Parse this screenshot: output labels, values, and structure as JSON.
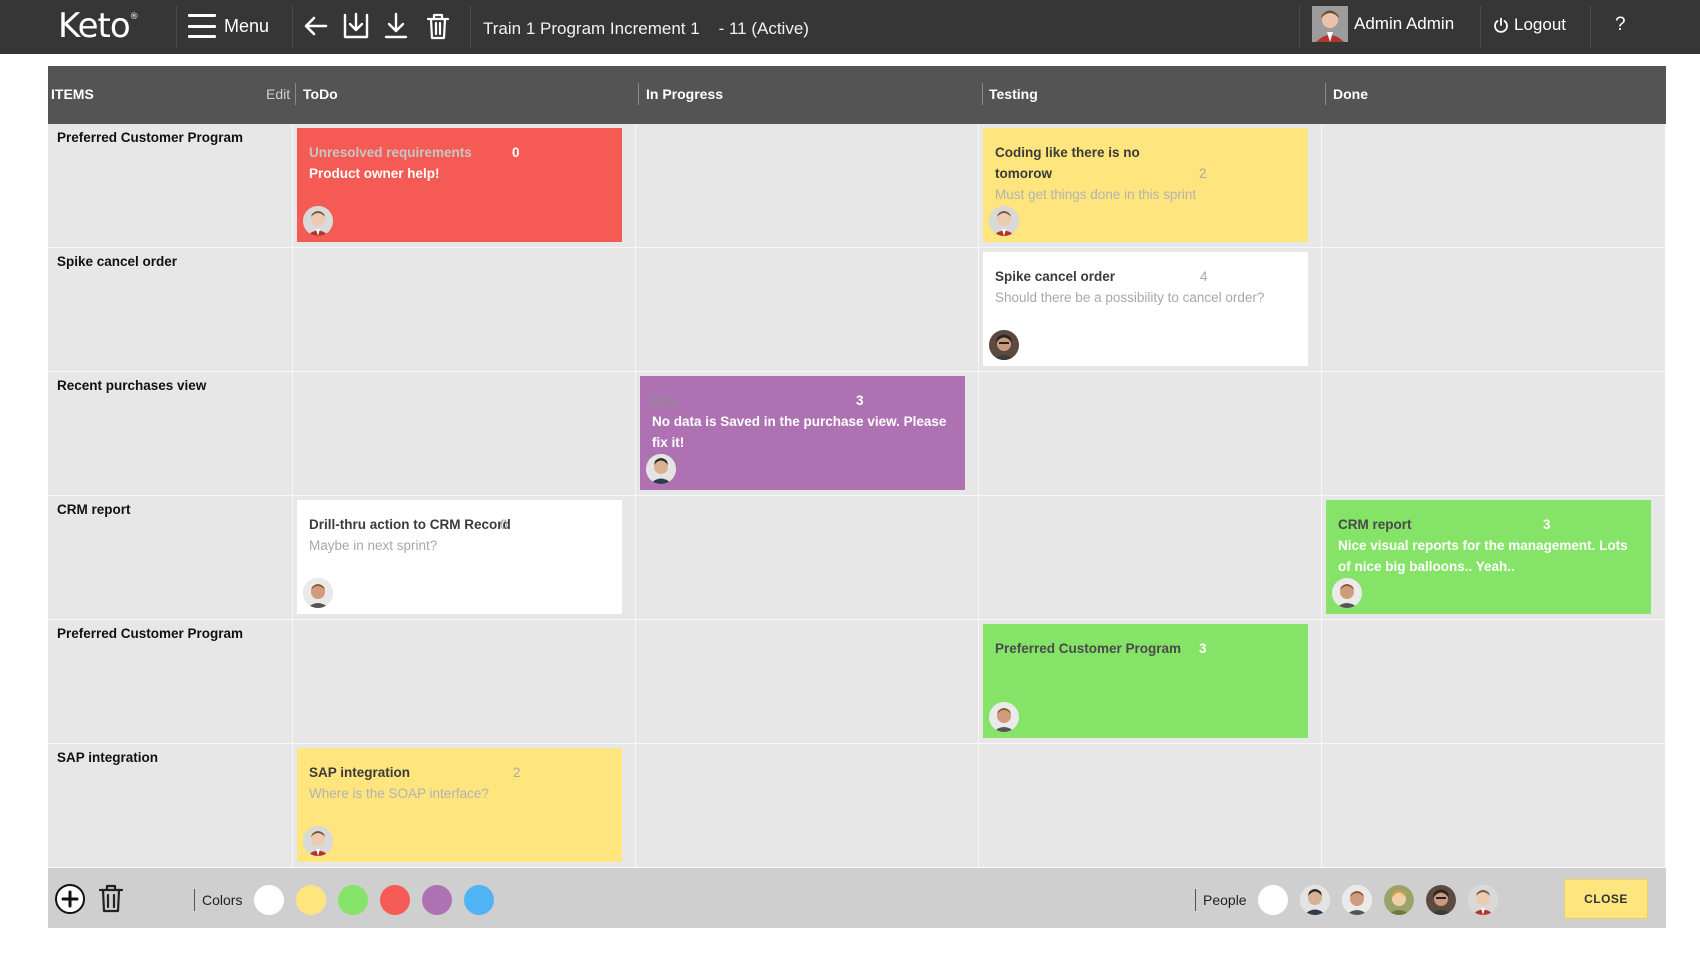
{
  "app": {
    "logo": "Keto",
    "logo_mark": "®",
    "menu_label": "Menu",
    "pi_title": "Train 1 Program Increment 1    - 11 (Active)",
    "user_name": "Admin Admin",
    "logout_label": "Logout",
    "help_label": "?"
  },
  "board": {
    "items_header": "ITEMS",
    "edit_label": "Edit",
    "columns": [
      "ToDo",
      "In Progress",
      "Testing",
      "Done"
    ],
    "rows": [
      {
        "label": "Preferred Customer Program"
      },
      {
        "label": "Spike cancel order"
      },
      {
        "label": "Recent purchases view"
      },
      {
        "label": "CRM report"
      },
      {
        "label": "Preferred Customer Program"
      },
      {
        "label": "SAP integration"
      }
    ],
    "cards": {
      "r0_todo": {
        "color": "red",
        "title": "Unresolved requirements",
        "num": "0",
        "desc": "Product owner help!"
      },
      "r0_testing": {
        "color": "yellow",
        "title": "Coding like there is no tomorow",
        "num": "2",
        "desc": "Must get things done in this sprint"
      },
      "r1_testing": {
        "color": "white",
        "title": "Spike cancel order",
        "num": "4",
        "desc": "Should there be a possibility to cancel order?"
      },
      "r2_inprogress": {
        "color": "purple",
        "title": "Bug",
        "num": "3",
        "desc": "No data is Saved in the purchase view. Please fix it!"
      },
      "r3_todo": {
        "color": "white",
        "title": "Drill-thru action to CRM Record",
        "num": "0",
        "desc": "Maybe in next sprint?"
      },
      "r3_done": {
        "color": "green",
        "title": "CRM report",
        "num": "3",
        "desc": "Nice visual reports for the management. Lots of nice big balloons.. Yeah.."
      },
      "r4_testing": {
        "color": "green",
        "title": "Preferred Customer Program",
        "num": "3",
        "desc": ""
      },
      "r5_todo": {
        "color": "yellow",
        "title": "SAP integration",
        "num": "2",
        "desc": "Where is the SOAP interface?"
      }
    }
  },
  "footer": {
    "colors_label": "Colors",
    "colors": [
      "#ffffff",
      "#fee57d",
      "#85e368",
      "#f55a55",
      "#ae72b3",
      "#4fb3f6"
    ],
    "people_label": "People",
    "close_label": "CLOSE"
  },
  "icons": {
    "logout": "power-icon",
    "add": "plus-circle-icon",
    "delete": "trash-icon",
    "back": "arrow-left-icon",
    "import": "import-icon",
    "download": "download-icon"
  }
}
